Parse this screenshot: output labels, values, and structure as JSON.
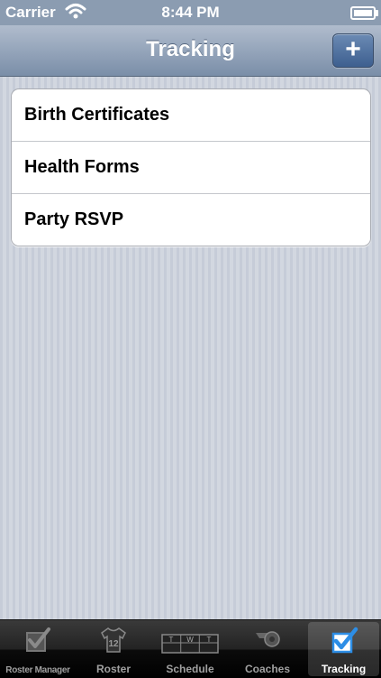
{
  "status_bar": {
    "carrier": "Carrier",
    "time": "8:44 PM"
  },
  "nav": {
    "title": "Tracking",
    "add_label": "+"
  },
  "list": {
    "items": [
      {
        "label": "Birth Certificates"
      },
      {
        "label": "Health Forms"
      },
      {
        "label": "Party RSVP"
      }
    ]
  },
  "tab_bar": {
    "tabs": [
      {
        "label": "Roster Manager",
        "icon": "checkbox-icon"
      },
      {
        "label": "Roster",
        "icon": "jersey-icon"
      },
      {
        "label": "Schedule",
        "icon": "calendar-icon",
        "icon_text": [
          "T",
          "W",
          "T"
        ]
      },
      {
        "label": "Coaches",
        "icon": "whistle-icon"
      },
      {
        "label": "Tracking",
        "icon": "check-icon",
        "active": true
      }
    ],
    "jersey_number": "12"
  },
  "colors": {
    "nav_bar": "#8b9cb1",
    "accent": "#3d5f8f",
    "active_tab": "#2d8ee6"
  }
}
